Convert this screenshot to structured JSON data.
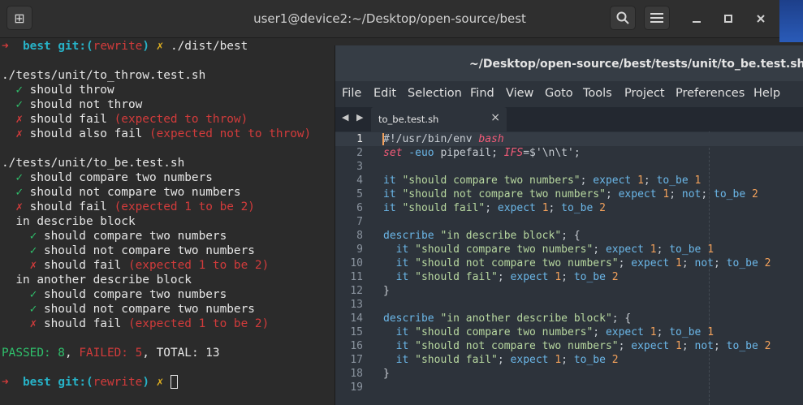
{
  "terminal": {
    "title": "user1@device2:~/Desktop/open-source/best",
    "lines": [
      {
        "parts": [
          {
            "t": "➜  ",
            "c": "r"
          },
          {
            "t": "best ",
            "c": "c"
          },
          {
            "t": "git:(",
            "c": "c"
          },
          {
            "t": "rewrite",
            "c": "r"
          },
          {
            "t": ")",
            "c": "c"
          },
          {
            "t": " ✗ ",
            "c": "y"
          },
          {
            "t": "./dist/best",
            "c": "w"
          }
        ]
      },
      {
        "parts": []
      },
      {
        "parts": [
          {
            "t": "./tests/unit/to_throw.test.sh",
            "c": "w"
          }
        ]
      },
      {
        "parts": [
          {
            "t": "  ✓ ",
            "c": "g"
          },
          {
            "t": "should throw",
            "c": "w"
          }
        ]
      },
      {
        "parts": [
          {
            "t": "  ✓ ",
            "c": "g"
          },
          {
            "t": "should not throw",
            "c": "w"
          }
        ]
      },
      {
        "parts": [
          {
            "t": "  ✗ ",
            "c": "r"
          },
          {
            "t": "should fail ",
            "c": "w"
          },
          {
            "t": "(expected to throw)",
            "c": "r"
          }
        ]
      },
      {
        "parts": [
          {
            "t": "  ✗ ",
            "c": "r"
          },
          {
            "t": "should also fail ",
            "c": "w"
          },
          {
            "t": "(expected not to throw)",
            "c": "r"
          }
        ]
      },
      {
        "parts": []
      },
      {
        "parts": [
          {
            "t": "./tests/unit/to_be.test.sh",
            "c": "w"
          }
        ]
      },
      {
        "parts": [
          {
            "t": "  ✓ ",
            "c": "g"
          },
          {
            "t": "should compare two numbers",
            "c": "w"
          }
        ]
      },
      {
        "parts": [
          {
            "t": "  ✓ ",
            "c": "g"
          },
          {
            "t": "should not compare two numbers",
            "c": "w"
          }
        ]
      },
      {
        "parts": [
          {
            "t": "  ✗ ",
            "c": "r"
          },
          {
            "t": "should fail ",
            "c": "w"
          },
          {
            "t": "(expected 1 to be 2)",
            "c": "r"
          }
        ]
      },
      {
        "parts": [
          {
            "t": "  in describe block",
            "c": "w"
          }
        ]
      },
      {
        "parts": [
          {
            "t": "    ✓ ",
            "c": "g"
          },
          {
            "t": "should compare two numbers",
            "c": "w"
          }
        ]
      },
      {
        "parts": [
          {
            "t": "    ✓ ",
            "c": "g"
          },
          {
            "t": "should not compare two numbers",
            "c": "w"
          }
        ]
      },
      {
        "parts": [
          {
            "t": "    ✗ ",
            "c": "r"
          },
          {
            "t": "should fail ",
            "c": "w"
          },
          {
            "t": "(expected 1 to be 2)",
            "c": "r"
          }
        ]
      },
      {
        "parts": [
          {
            "t": "  in another describe block",
            "c": "w"
          }
        ]
      },
      {
        "parts": [
          {
            "t": "    ✓ ",
            "c": "g"
          },
          {
            "t": "should compare two numbers",
            "c": "w"
          }
        ]
      },
      {
        "parts": [
          {
            "t": "    ✓ ",
            "c": "g"
          },
          {
            "t": "should not compare two numbers",
            "c": "w"
          }
        ]
      },
      {
        "parts": [
          {
            "t": "    ✗ ",
            "c": "r"
          },
          {
            "t": "should fail ",
            "c": "w"
          },
          {
            "t": "(expected 1 to be 2)",
            "c": "r"
          }
        ]
      },
      {
        "parts": []
      },
      {
        "parts": [
          {
            "t": "PASSED: 8",
            "c": "g"
          },
          {
            "t": ", ",
            "c": "w"
          },
          {
            "t": "FAILED: 5",
            "c": "r"
          },
          {
            "t": ", TOTAL: 13",
            "c": "w"
          }
        ]
      },
      {
        "parts": []
      },
      {
        "parts": [
          {
            "t": "➜  ",
            "c": "r"
          },
          {
            "t": "best ",
            "c": "c"
          },
          {
            "t": "git:(",
            "c": "c"
          },
          {
            "t": "rewrite",
            "c": "r"
          },
          {
            "t": ")",
            "c": "c"
          },
          {
            "t": " ✗ ",
            "c": "y"
          },
          {
            "t": "",
            "c": "cursor"
          }
        ]
      }
    ]
  },
  "editor": {
    "title": "~/Desktop/open-source/best/tests/unit/to_be.test.sh (best)",
    "menu": [
      "File",
      "Edit",
      "Selection",
      "Find",
      "View",
      "Goto",
      "Tools",
      "Project",
      "Preferences",
      "Help"
    ],
    "tab_label": "to_be.test.sh",
    "tab_close": "×",
    "tab_arrows": "◀ ▶",
    "code": [
      [
        {
          "t": "#!/usr/bin/env ",
          "k": "op"
        },
        {
          "t": "bash",
          "k": "it"
        }
      ],
      [
        {
          "t": "set",
          "k": "it"
        },
        {
          "t": " -euo ",
          "k": "kw"
        },
        {
          "t": "pipefail; ",
          "k": "op"
        },
        {
          "t": "IFS",
          "k": "it"
        },
        {
          "t": "=$'\\n\\t';",
          "k": "op"
        }
      ],
      [],
      [
        {
          "t": "it ",
          "k": "kw"
        },
        {
          "t": "\"should compare two numbers\"",
          "k": "str"
        },
        {
          "t": "; ",
          "k": "op"
        },
        {
          "t": "expect ",
          "k": "kw"
        },
        {
          "t": "1",
          "k": "num-t"
        },
        {
          "t": "; ",
          "k": "op"
        },
        {
          "t": "to_be ",
          "k": "kw"
        },
        {
          "t": "1",
          "k": "num-t"
        }
      ],
      [
        {
          "t": "it ",
          "k": "kw"
        },
        {
          "t": "\"should not compare two numbers\"",
          "k": "str"
        },
        {
          "t": "; ",
          "k": "op"
        },
        {
          "t": "expect ",
          "k": "kw"
        },
        {
          "t": "1",
          "k": "num-t"
        },
        {
          "t": "; ",
          "k": "op"
        },
        {
          "t": "not",
          "k": "kw"
        },
        {
          "t": "; ",
          "k": "op"
        },
        {
          "t": "to_be ",
          "k": "kw"
        },
        {
          "t": "2",
          "k": "num-t"
        }
      ],
      [
        {
          "t": "it ",
          "k": "kw"
        },
        {
          "t": "\"should fail\"",
          "k": "str"
        },
        {
          "t": "; ",
          "k": "op"
        },
        {
          "t": "expect ",
          "k": "kw"
        },
        {
          "t": "1",
          "k": "num-t"
        },
        {
          "t": "; ",
          "k": "op"
        },
        {
          "t": "to_be ",
          "k": "kw"
        },
        {
          "t": "2",
          "k": "num-t"
        }
      ],
      [],
      [
        {
          "t": "describe ",
          "k": "kw"
        },
        {
          "t": "\"in describe block\"",
          "k": "str"
        },
        {
          "t": "; {",
          "k": "op"
        }
      ],
      [
        {
          "t": "  it ",
          "k": "kw"
        },
        {
          "t": "\"should compare two numbers\"",
          "k": "str"
        },
        {
          "t": "; ",
          "k": "op"
        },
        {
          "t": "expect ",
          "k": "kw"
        },
        {
          "t": "1",
          "k": "num-t"
        },
        {
          "t": "; ",
          "k": "op"
        },
        {
          "t": "to_be ",
          "k": "kw"
        },
        {
          "t": "1",
          "k": "num-t"
        }
      ],
      [
        {
          "t": "  it ",
          "k": "kw"
        },
        {
          "t": "\"should not compare two numbers\"",
          "k": "str"
        },
        {
          "t": "; ",
          "k": "op"
        },
        {
          "t": "expect ",
          "k": "kw"
        },
        {
          "t": "1",
          "k": "num-t"
        },
        {
          "t": "; ",
          "k": "op"
        },
        {
          "t": "not",
          "k": "kw"
        },
        {
          "t": "; ",
          "k": "op"
        },
        {
          "t": "to_be ",
          "k": "kw"
        },
        {
          "t": "2",
          "k": "num-t"
        }
      ],
      [
        {
          "t": "  it ",
          "k": "kw"
        },
        {
          "t": "\"should fail\"",
          "k": "str"
        },
        {
          "t": "; ",
          "k": "op"
        },
        {
          "t": "expect ",
          "k": "kw"
        },
        {
          "t": "1",
          "k": "num-t"
        },
        {
          "t": "; ",
          "k": "op"
        },
        {
          "t": "to_be ",
          "k": "kw"
        },
        {
          "t": "2",
          "k": "num-t"
        }
      ],
      [
        {
          "t": "}",
          "k": "op"
        }
      ],
      [],
      [
        {
          "t": "describe ",
          "k": "kw"
        },
        {
          "t": "\"in another describe block\"",
          "k": "str"
        },
        {
          "t": "; {",
          "k": "op"
        }
      ],
      [
        {
          "t": "  it ",
          "k": "kw"
        },
        {
          "t": "\"should compare two numbers\"",
          "k": "str"
        },
        {
          "t": "; ",
          "k": "op"
        },
        {
          "t": "expect ",
          "k": "kw"
        },
        {
          "t": "1",
          "k": "num-t"
        },
        {
          "t": "; ",
          "k": "op"
        },
        {
          "t": "to_be ",
          "k": "kw"
        },
        {
          "t": "1",
          "k": "num-t"
        }
      ],
      [
        {
          "t": "  it ",
          "k": "kw"
        },
        {
          "t": "\"should not compare two numbers\"",
          "k": "str"
        },
        {
          "t": "; ",
          "k": "op"
        },
        {
          "t": "expect ",
          "k": "kw"
        },
        {
          "t": "1",
          "k": "num-t"
        },
        {
          "t": "; ",
          "k": "op"
        },
        {
          "t": "not",
          "k": "kw"
        },
        {
          "t": "; ",
          "k": "op"
        },
        {
          "t": "to_be ",
          "k": "kw"
        },
        {
          "t": "2",
          "k": "num-t"
        }
      ],
      [
        {
          "t": "  it ",
          "k": "kw"
        },
        {
          "t": "\"should fail\"",
          "k": "str"
        },
        {
          "t": "; ",
          "k": "op"
        },
        {
          "t": "expect ",
          "k": "kw"
        },
        {
          "t": "1",
          "k": "num-t"
        },
        {
          "t": "; ",
          "k": "op"
        },
        {
          "t": "to_be ",
          "k": "kw"
        },
        {
          "t": "2",
          "k": "num-t"
        }
      ],
      [
        {
          "t": "}",
          "k": "op"
        }
      ],
      []
    ]
  },
  "colors": {
    "green": "#2fbf6b",
    "red": "#d23b3b",
    "cyan": "#27b3c8",
    "yellow": "#e0b020"
  }
}
